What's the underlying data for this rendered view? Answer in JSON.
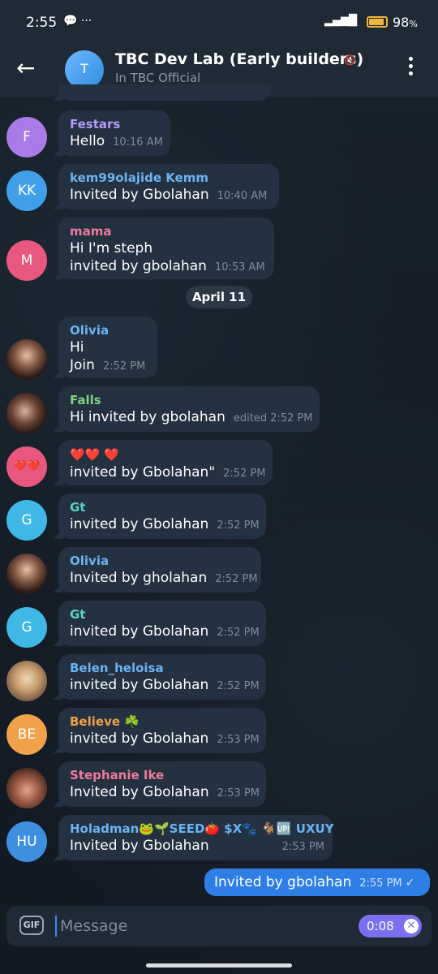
{
  "status": {
    "time": "2:55",
    "icons_left": "💬 ···",
    "signal": "📶",
    "wifi": "wifi",
    "battery_pct": "98",
    "battery_level": 0.98
  },
  "header": {
    "back_icon": "←",
    "avatar_letter": "T",
    "title": "TBC Dev Lab (Early builders)",
    "subtitle": "In TBC Official",
    "mute_icon": "🔇"
  },
  "date_divider": "April 11",
  "messages": [
    {
      "sender": "Festars",
      "sender_color": "#b19df7",
      "avatar_text": "F",
      "avatar_color": "#a97be6",
      "lines": [
        "Hello"
      ],
      "time": "10:16 AM"
    },
    {
      "sender": "kem99olajide Kemm",
      "sender_color": "#6ab3f3",
      "avatar_text": "KK",
      "avatar_color": "#3f9fe8",
      "lines": [
        "Invited by Gbolahan"
      ],
      "time": "10:40 AM"
    },
    {
      "sender": "mama",
      "sender_color": "#ee7a9b",
      "avatar_text": "M",
      "avatar_color": "#e8587e",
      "lines": [
        "Hi I'm steph",
        "invited by gbolahan"
      ],
      "time": "10:53 AM"
    },
    {
      "sender": "Olivia",
      "sender_color": "#6ab3f3",
      "avatar_text": "",
      "lines": [
        "Hi",
        "Join"
      ],
      "time": "2:52 PM"
    },
    {
      "sender": "Falls",
      "sender_color": "#7fd17f",
      "avatar_text": "",
      "lines": [
        "Hi invited by gbolahan"
      ],
      "edited": "edited",
      "time": "2:52 PM"
    },
    {
      "sender": "",
      "avatar_text": "❤️❤️",
      "avatar_color": "#e8587e",
      "lines": [
        "❤️❤️ ❤️",
        "invited by Gbolahan\""
      ],
      "time": "2:52 PM"
    },
    {
      "sender": "Gt",
      "sender_color": "#5fd0c9",
      "avatar_text": "G",
      "avatar_color": "#3fb8e6",
      "lines": [
        "invited by Gbolahan"
      ],
      "time": "2:52 PM"
    },
    {
      "sender": "Olivia",
      "sender_color": "#6ab3f3",
      "avatar_text": "",
      "lines": [
        "Invited by gholahan"
      ],
      "time": "2:52 PM"
    },
    {
      "sender": "Gt",
      "sender_color": "#5fd0c9",
      "avatar_text": "G",
      "avatar_color": "#3fb8e6",
      "lines": [
        "invited by Gbolahan"
      ],
      "time": "2:52 PM"
    },
    {
      "sender": "Belen_heloisa",
      "sender_color": "#6ab3f3",
      "avatar_text": "",
      "lines": [
        "invited by Gbolahan"
      ],
      "time": "2:52 PM"
    },
    {
      "sender": "Believe ☘️",
      "sender_color": "#f0a14a",
      "avatar_text": "BE",
      "avatar_color": "#f0a14a",
      "lines": [
        "invited by Gbolahan"
      ],
      "time": "2:53 PM"
    },
    {
      "sender": "Stephanie Ike",
      "sender_color": "#ee7a9b",
      "avatar_text": "",
      "lines": [
        "Invited by Gbolahan"
      ],
      "time": "2:53 PM"
    },
    {
      "sender": "Holadman🐸🌱SEED🍅 $X🐾 🐐🆙 UXUY",
      "sender_color": "#6ab3f3",
      "avatar_text": "HU",
      "avatar_color": "#3f8fe0",
      "lines": [
        "Invited by Gbolahan"
      ],
      "time": "2:53 PM"
    }
  ],
  "outgoing": {
    "text": "Invited by gbolahan",
    "time": "2:55 PM",
    "check": "✓"
  },
  "input": {
    "gif_label": "GIF",
    "placeholder": "Message",
    "timer": "0:08",
    "timer_close": "✕"
  }
}
